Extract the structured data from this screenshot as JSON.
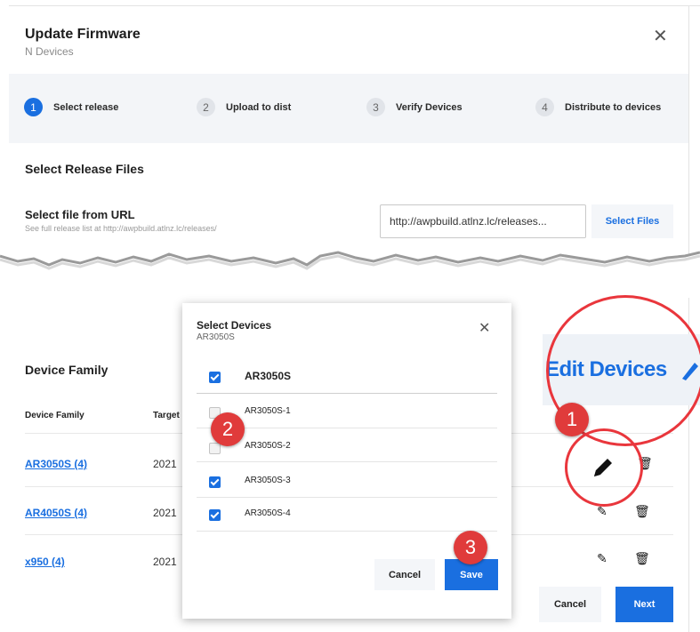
{
  "dialog": {
    "title": "Update Firmware",
    "subtitle": "N Devices",
    "close_icon": "close-icon"
  },
  "steps": [
    {
      "num": "1",
      "label": "Select release",
      "active": true
    },
    {
      "num": "2",
      "label": "Upload to dist",
      "active": false
    },
    {
      "num": "3",
      "label": "Verify Devices",
      "active": false
    },
    {
      "num": "4",
      "label": "Distribute to devices",
      "active": false
    }
  ],
  "release": {
    "section_title": "Select Release Files",
    "url_label": "Select file from URL",
    "url_help": "See full release list at http://awpbuild.atlnz.lc/releases/",
    "url_value": "http://awpbuild.atlnz.lc/releases...",
    "select_files_label": "Select Files"
  },
  "device_family": {
    "title": "Device Family",
    "columns": [
      "Device Family",
      "Target"
    ],
    "rows": [
      {
        "name": "AR3050S (4)",
        "date": "2021"
      },
      {
        "name": "AR4050S (4)",
        "date": "2021"
      },
      {
        "name": "x950 (4)",
        "date": "2021"
      }
    ]
  },
  "modal": {
    "title": "Select Devices",
    "subtitle": "AR3050S",
    "group_label": "AR3050S",
    "group_checked": true,
    "devices": [
      {
        "label": "AR3050S-1",
        "checked": false
      },
      {
        "label": "AR3050S-2",
        "checked": false
      },
      {
        "label": "AR3050S-3",
        "checked": true
      },
      {
        "label": "AR3050S-4",
        "checked": true
      }
    ],
    "cancel_label": "Cancel",
    "save_label": "Save"
  },
  "footer": {
    "cancel_label": "Cancel",
    "next_label": "Next"
  },
  "callout": {
    "zoom_text": "Edit Devices",
    "badges": [
      "1",
      "2",
      "3"
    ]
  },
  "colors": {
    "accent": "#1a6fe0",
    "callout_red": "#e03b3b"
  }
}
